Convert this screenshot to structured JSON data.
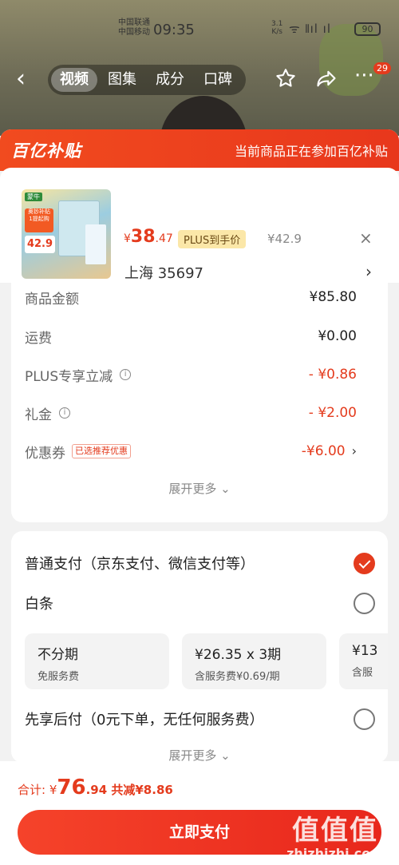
{
  "status_bar": {
    "carrier1": "中国联通",
    "carrier2": "中国移动",
    "time": "09:35",
    "speed": "3.1\nK/s",
    "signal": "ᯤ 𝍪ıl ıl",
    "battery": "90"
  },
  "nav": {
    "back": "‹",
    "tabs": [
      "视频",
      "图集",
      "成分",
      "口碑"
    ],
    "active_tab": 0,
    "badge": "29"
  },
  "banner": {
    "logo": "百亿补贴",
    "text": "当前商品正在参加百亿补贴"
  },
  "product": {
    "brand_tag": "蒙牛",
    "promo_line1": "奥钞补贴",
    "promo_line2": "1提起购",
    "promo_price": "42.9",
    "price_prefix": "¥",
    "price_int": "38",
    "price_dec": ".47",
    "plus_label": "PLUS到手价",
    "original_price": "¥42.9",
    "close": "×",
    "address": "上海  35697",
    "address_chevron": "›"
  },
  "amounts": {
    "goods_label": "商品金额",
    "goods_value": "¥85.80",
    "shipping_label": "运费",
    "shipping_value": "¥0.00",
    "plus_discount_label": "PLUS专享立减",
    "plus_discount_value": "- ¥0.86",
    "gift_label": "礼金",
    "gift_value": "- ¥2.00",
    "coupon_label": "优惠券",
    "coupon_tag": "已选推荐优惠",
    "coupon_value": "-¥6.00",
    "coupon_chevron": "›",
    "more": "展开更多 ⌄"
  },
  "payment": {
    "normal_label": "普通支付（京东支付、微信支付等）",
    "baitiao_label": "白条",
    "plans": [
      {
        "title": "不分期",
        "sub": "免服务费"
      },
      {
        "title": "¥26.35 x 3期",
        "sub": "含服务费¥0.69/期"
      },
      {
        "title": "¥13",
        "sub": "含服"
      }
    ],
    "later_label": "先享后付（0元下单，无任何服务费）",
    "more": "展开更多 ⌄",
    "selected": "normal"
  },
  "footer": {
    "total_label": "合计: ",
    "total_prefix": "¥",
    "total_int": "76",
    "total_dec": ".94",
    "saved_label": " 共减",
    "saved_value": "¥8.86",
    "pay_button": "立即支付"
  },
  "watermark": {
    "line1": "值值值",
    "line2": "zhizhizhi.com"
  },
  "colors": {
    "accent": "#e43b1d",
    "banner": "#f14b1f",
    "plus_bg": "#fbe7a8"
  }
}
